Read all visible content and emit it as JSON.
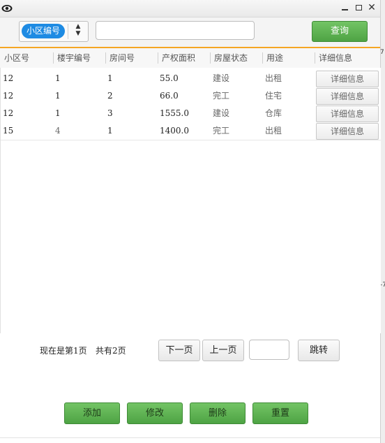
{
  "window": {
    "controls": [
      "minimize-icon",
      "maximize-icon",
      "close-icon"
    ],
    "close_glyph": "✕"
  },
  "search": {
    "field_label": "小区编号",
    "query_value": "",
    "query_button": "查询"
  },
  "table": {
    "columns": [
      "小区号",
      "楼宇编号",
      "房间号",
      "产权面积",
      "房屋状态",
      "用途",
      "详细信息"
    ],
    "rows": [
      {
        "c0": "12",
        "c1": "1",
        "c2": "1",
        "c3": "55.0",
        "c4": "建设",
        "c5": "出租",
        "c6": "详细信息"
      },
      {
        "c0": "12",
        "c1": "1",
        "c2": "2",
        "c3": "66.0",
        "c4": "完工",
        "c5": "住宅",
        "c6": "详细信息"
      },
      {
        "c0": "12",
        "c1": "1",
        "c2": "3",
        "c3": "1555.0",
        "c4": "建设",
        "c5": "仓库",
        "c6": "详细信息"
      },
      {
        "c0": "15",
        "c1": "4",
        "c2": "1",
        "c3": "1400.0",
        "c4": "完工",
        "c5": "出租",
        "c6": "详细信息"
      }
    ]
  },
  "pagination": {
    "current_page_text": "现在是第1页",
    "total_pages_text": "共有2页",
    "next_label": "下一页",
    "prev_label": "上一页",
    "jump_value": "",
    "jump_label": "跳转"
  },
  "actions": {
    "add": "添加",
    "edit": "修改",
    "delete": "删除",
    "reset": "重置"
  },
  "background": {
    "right_strip_marks": [
      "7",
      "-7"
    ]
  },
  "colors": {
    "accent_orange": "#f5a623",
    "green_button": "#5cb350",
    "selected_blue": "#1e8be3"
  }
}
